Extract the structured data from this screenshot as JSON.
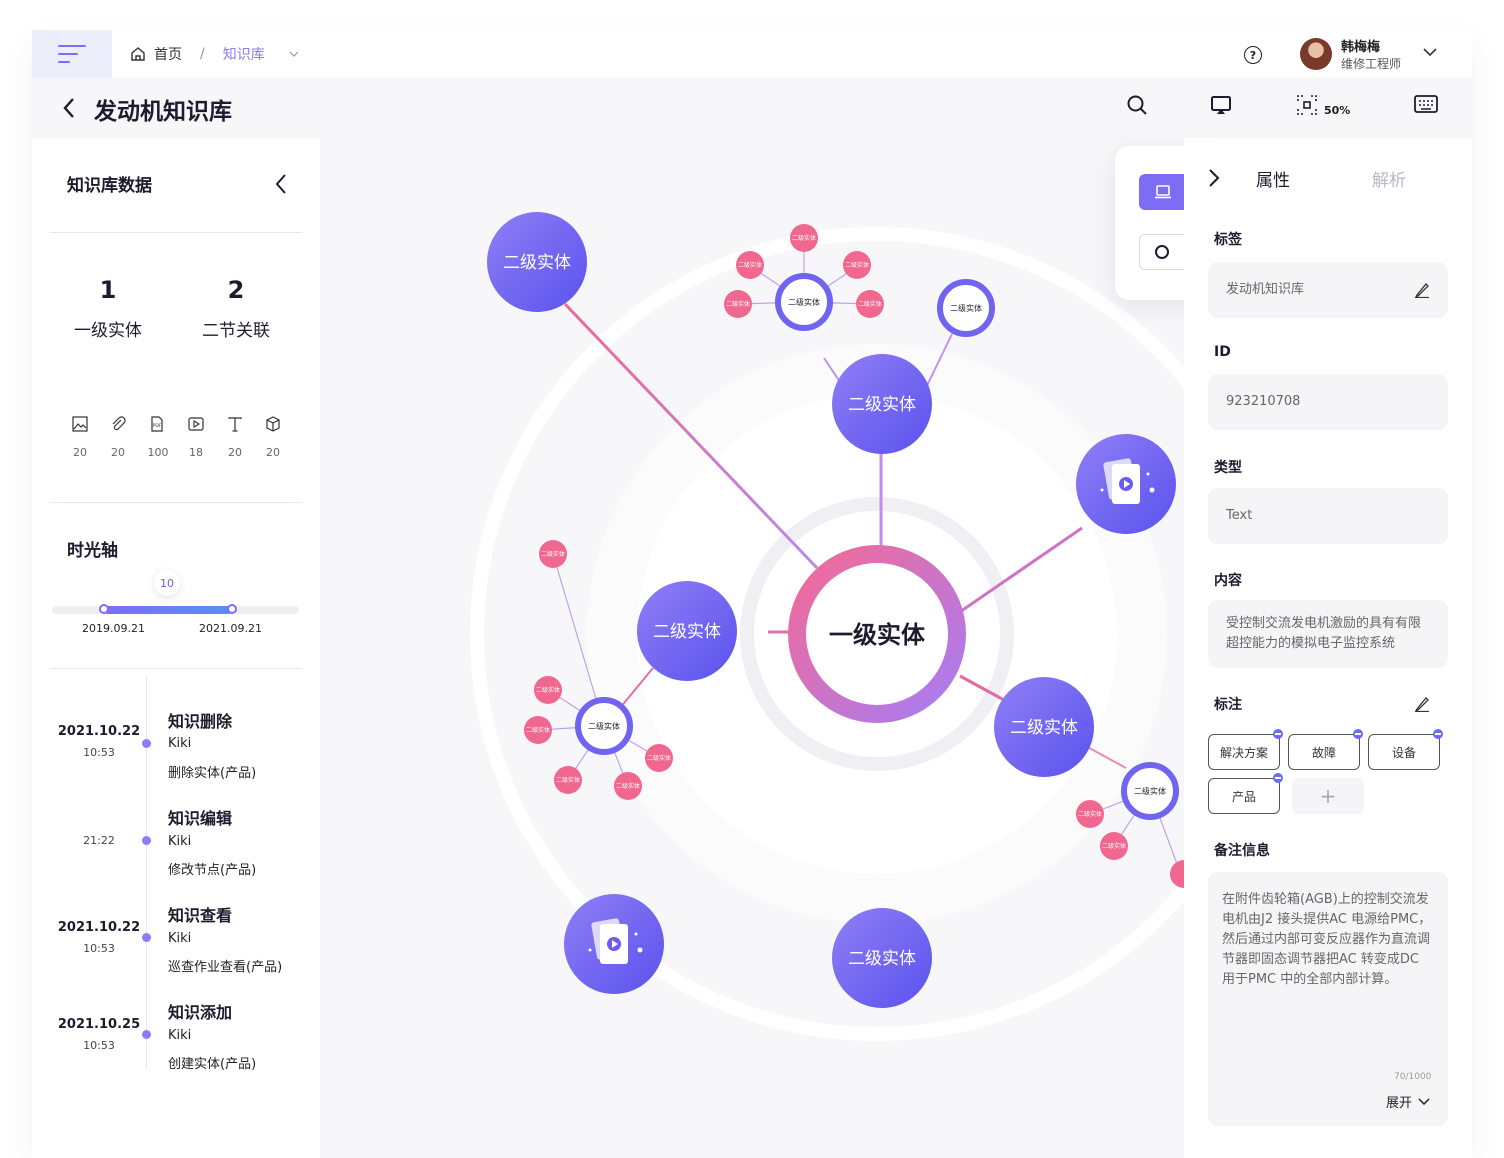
{
  "topbar": {
    "crumb_home": "首页",
    "crumb_sep": "/",
    "crumb_current": "知识库",
    "help_glyph": "?",
    "user_name": "韩梅梅",
    "user_role": "维修工程师"
  },
  "titlebar": {
    "title": "发动机知识库",
    "zoom": "50%"
  },
  "left": {
    "header": "知识库数据",
    "stats": [
      {
        "num": "1",
        "label": "一级实体"
      },
      {
        "num": "2",
        "label": "二节关联"
      }
    ],
    "file_types": [
      {
        "icon": "image-icon",
        "count": "20"
      },
      {
        "icon": "attachment-icon",
        "count": "20"
      },
      {
        "icon": "pdf-icon",
        "count": "100"
      },
      {
        "icon": "video-icon",
        "count": "18"
      },
      {
        "icon": "text-icon",
        "count": "20"
      },
      {
        "icon": "cube-icon",
        "count": "20"
      }
    ],
    "timeline_header": "时光轴",
    "slider_value": "10",
    "slider_start": "2019.09.21",
    "slider_end": "2021.09.21",
    "events": [
      {
        "date": "2021.10.22",
        "time": "10:53",
        "title": "知识删除",
        "user": "Kiki",
        "desc": "删除实体(产品)"
      },
      {
        "date": "",
        "time": "21:22",
        "title": "知识编辑",
        "user": "Kiki",
        "desc": "修改节点(产品)"
      },
      {
        "date": "2021.10.22",
        "time": "10:53",
        "title": "知识查看",
        "user": "Kiki",
        "desc": "巡查作业查看(产品)"
      },
      {
        "date": "2021.10.25",
        "time": "10:53",
        "title": "知识添加",
        "user": "Kiki",
        "desc": "创建实体(产品)"
      }
    ]
  },
  "graph": {
    "center_label": "一级实体",
    "secondary_label": "二级实体",
    "tertiary_label": "二级实体",
    "colors": {
      "purple": "#6a5cf0",
      "pink": "#f06790",
      "accent": "#7d6cf4"
    }
  },
  "right": {
    "tab_properties": "属性",
    "tab_analysis": "解析",
    "label_tag": "标签",
    "tag_value": "发动机知识库",
    "label_id": "ID",
    "id_value": "923210708",
    "label_type": "类型",
    "type_value": "Text",
    "label_content": "内容",
    "content_value": "受控制交流发电机激励的具有有限超控能力的模拟电子监控系统",
    "label_annotation": "标注",
    "annotations": [
      "解决方案",
      "故障",
      "设备",
      "产品"
    ],
    "add_glyph": "+",
    "label_notes": "备注信息",
    "notes_value": "在附件齿轮箱(AGB)上的控制交流发电机由J2 接头提供AC 电源给PMC，然后通过内部可变反应器作为直流调节器即固态调节器把AC 转变成DC 用于PMC 中的全部内部计算。",
    "notes_count": "70/1000",
    "expand_label": "展开"
  }
}
